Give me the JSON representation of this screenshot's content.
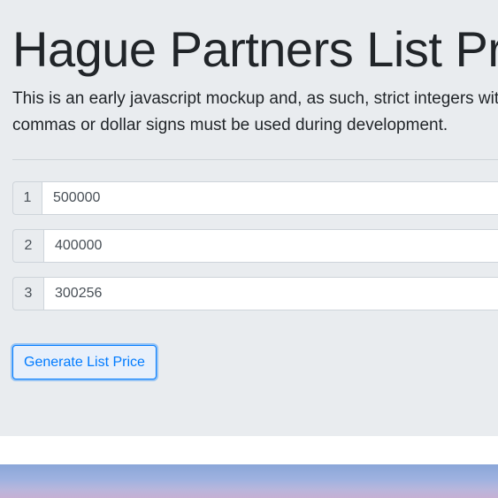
{
  "header": {
    "title": "Hague Partners List Price Generator",
    "description": "This is an early javascript mockup and, as such, strict integers without commas or dollar signs must be used during development."
  },
  "inputs": [
    {
      "index": "1",
      "value": "500000"
    },
    {
      "index": "2",
      "value": "400000"
    },
    {
      "index": "3",
      "value": "300256"
    }
  ],
  "actions": {
    "generate_label": "Generate List Price"
  },
  "colors": {
    "jumbotron_bg": "#e9ecef",
    "accent": "#007bff"
  }
}
